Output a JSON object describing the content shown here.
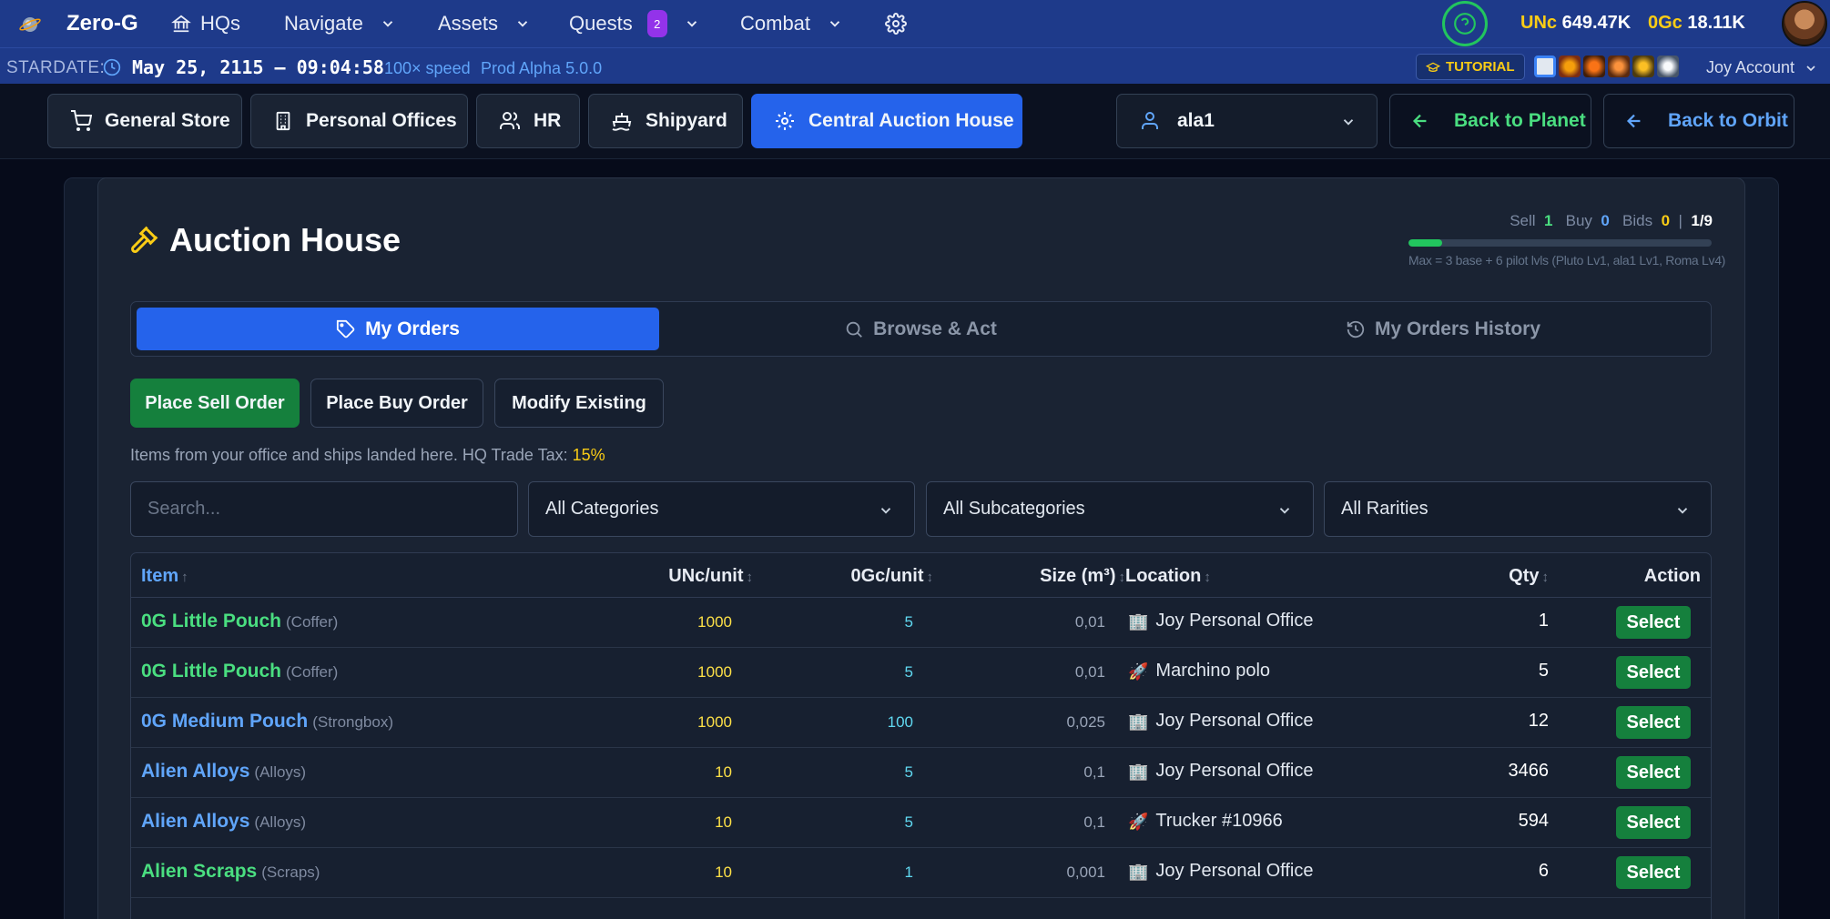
{
  "nav": {
    "brand": "Zero-G",
    "items": [
      {
        "label": "HQs",
        "icon": "bank-icon"
      },
      {
        "label": "Navigate",
        "icon": "chevron-down-icon"
      },
      {
        "label": "Assets",
        "icon": "chevron-down-icon"
      },
      {
        "label": "Quests",
        "icon": "chevron-down-icon",
        "badge": "2"
      },
      {
        "label": "Combat",
        "icon": "chevron-down-icon"
      }
    ],
    "currency": {
      "unc_label": "UNc",
      "unc_value": "649.47K",
      "gc_label": "0Gc",
      "gc_value": "18.11K"
    }
  },
  "datebar": {
    "label": "STARDATE:",
    "date": "May 25, 2115 — 09:04:58",
    "speed": "100× speed",
    "version": "Prod Alpha 5.0.0",
    "tutorial": "TUTORIAL",
    "account": "Joy Account"
  },
  "sections": {
    "tabs": [
      {
        "label": "General Store",
        "icon": "cart-icon"
      },
      {
        "label": "Personal Offices",
        "icon": "building-icon"
      },
      {
        "label": "HR",
        "icon": "users-icon"
      },
      {
        "label": "Shipyard",
        "icon": "ship-icon"
      },
      {
        "label": "Central Auction House",
        "icon": "gear-icon",
        "active": true
      }
    ],
    "character": "ala1",
    "back_planet": "Back to Planet",
    "back_orbit": "Back to Orbit"
  },
  "auction": {
    "title": "Auction House",
    "stats": {
      "sell_label": "Sell",
      "sell": "1",
      "buy_label": "Buy",
      "buy": "0",
      "bids_label": "Bids",
      "bids": "0",
      "sep": "|",
      "slots": "1/9",
      "fill_fraction": 0.111
    },
    "max_note": "Max = 3 base + 6 pilot lvls (Pluto Lv1, ala1 Lv1, Roma Lv4)",
    "subtabs": [
      {
        "label": "My Orders",
        "icon": "tag-icon"
      },
      {
        "label": "Browse & Act",
        "icon": "search-icon"
      },
      {
        "label": "My Orders History",
        "icon": "history-icon"
      }
    ],
    "actions": {
      "sell": "Place Sell Order",
      "buy": "Place Buy Order",
      "modify": "Modify Existing"
    },
    "note_prefix": "Items from your office and ships landed here. HQ Trade Tax: ",
    "note_tax": "15%",
    "filters": {
      "search_placeholder": "Search...",
      "category": "All Categories",
      "subcategory": "All Subcategories",
      "rarity": "All Rarities"
    },
    "columns": {
      "item": "Item",
      "item_sort": "↑",
      "unc": "UNc/unit",
      "gc": "0Gc/unit",
      "size": "Size (m³)",
      "location": "Location",
      "qty": "Qty",
      "action": "Action",
      "sort": "↕"
    },
    "rows": [
      {
        "name": "0G Little Pouch",
        "category": "(Coffer)",
        "color": "#4ade80",
        "unc": "1000",
        "gc": "5",
        "size": "0,01",
        "loc_icon": "🏢",
        "location": "Joy Personal Office",
        "qty": "1",
        "action": "Select"
      },
      {
        "name": "0G Little Pouch",
        "category": "(Coffer)",
        "color": "#4ade80",
        "unc": "1000",
        "gc": "5",
        "size": "0,01",
        "loc_icon": "🚀",
        "location": "Marchino polo",
        "qty": "5",
        "action": "Select"
      },
      {
        "name": "0G Medium Pouch",
        "category": "(Strongbox)",
        "color": "#60a5fa",
        "unc": "1000",
        "gc": "100",
        "size": "0,025",
        "loc_icon": "🏢",
        "location": "Joy Personal Office",
        "qty": "12",
        "action": "Select"
      },
      {
        "name": "Alien Alloys",
        "category": "(Alloys)",
        "color": "#60a5fa",
        "unc": "10",
        "gc": "5",
        "size": "0,1",
        "loc_icon": "🏢",
        "location": "Joy Personal Office",
        "qty": "3466",
        "action": "Select"
      },
      {
        "name": "Alien Alloys",
        "category": "(Alloys)",
        "color": "#60a5fa",
        "unc": "10",
        "gc": "5",
        "size": "0,1",
        "loc_icon": "🚀",
        "location": "Trucker #10966",
        "qty": "594",
        "action": "Select"
      },
      {
        "name": "Alien Scraps",
        "category": "(Scraps)",
        "color": "#4ade80",
        "unc": "10",
        "gc": "1",
        "size": "0,001",
        "loc_icon": "🏢",
        "location": "Joy Personal Office",
        "qty": "6",
        "action": "Select"
      }
    ]
  }
}
